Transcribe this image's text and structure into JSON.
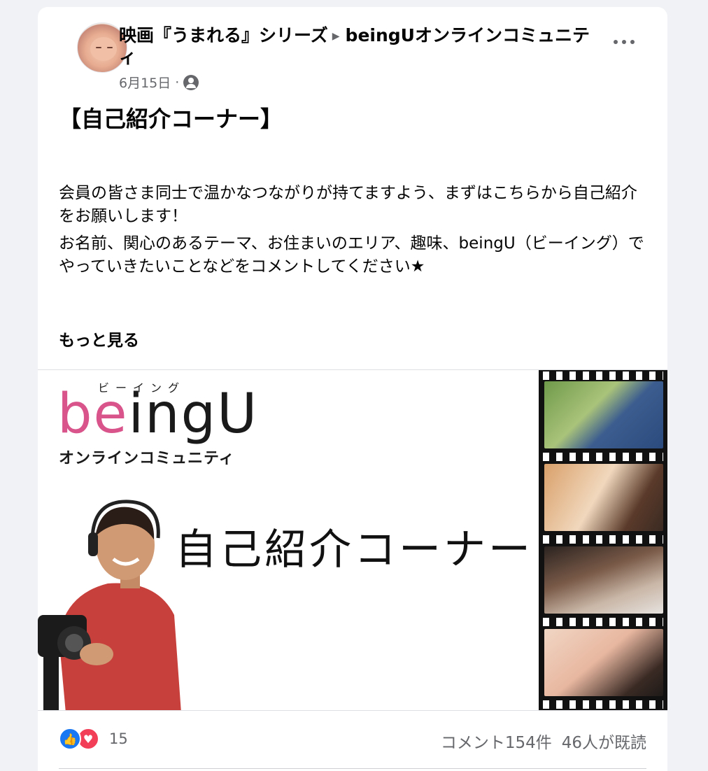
{
  "post": {
    "author": "映画『うまれる』シリーズ",
    "separator": "▶",
    "group": "beingUオンラインコミュニティ",
    "date": "6月15日",
    "date_dot": "·",
    "audience_icon": "group-icon",
    "heading": "【自己紹介コーナー】",
    "paragraphs": [
      "会員の皆さま同士で温かなつながりが持てますよう、まずはこちらから自己紹介をお願いします！",
      "お名前、関心のあるテーマ、お住まいのエリア、趣味、beingU（ビーイング）でやっていきたいことなどをコメントしてください★"
    ],
    "see_more": "もっと見る"
  },
  "banner": {
    "ruby": "ビーイング",
    "logo_pink": "be",
    "logo_dark": "ingU",
    "logo_sub": "オンラインコミュニティ",
    "title": "自己紹介コーナー"
  },
  "stats": {
    "reaction_count": "15",
    "like_icon": "like-icon",
    "love_icon": "love-icon",
    "comments": "コメント154件",
    "seen": "46人が既読"
  },
  "colors": {
    "brand_blue": "#1877f2",
    "love_red": "#f33e58",
    "logo_pink": "#d8548b",
    "secondary_text": "#65676b"
  }
}
